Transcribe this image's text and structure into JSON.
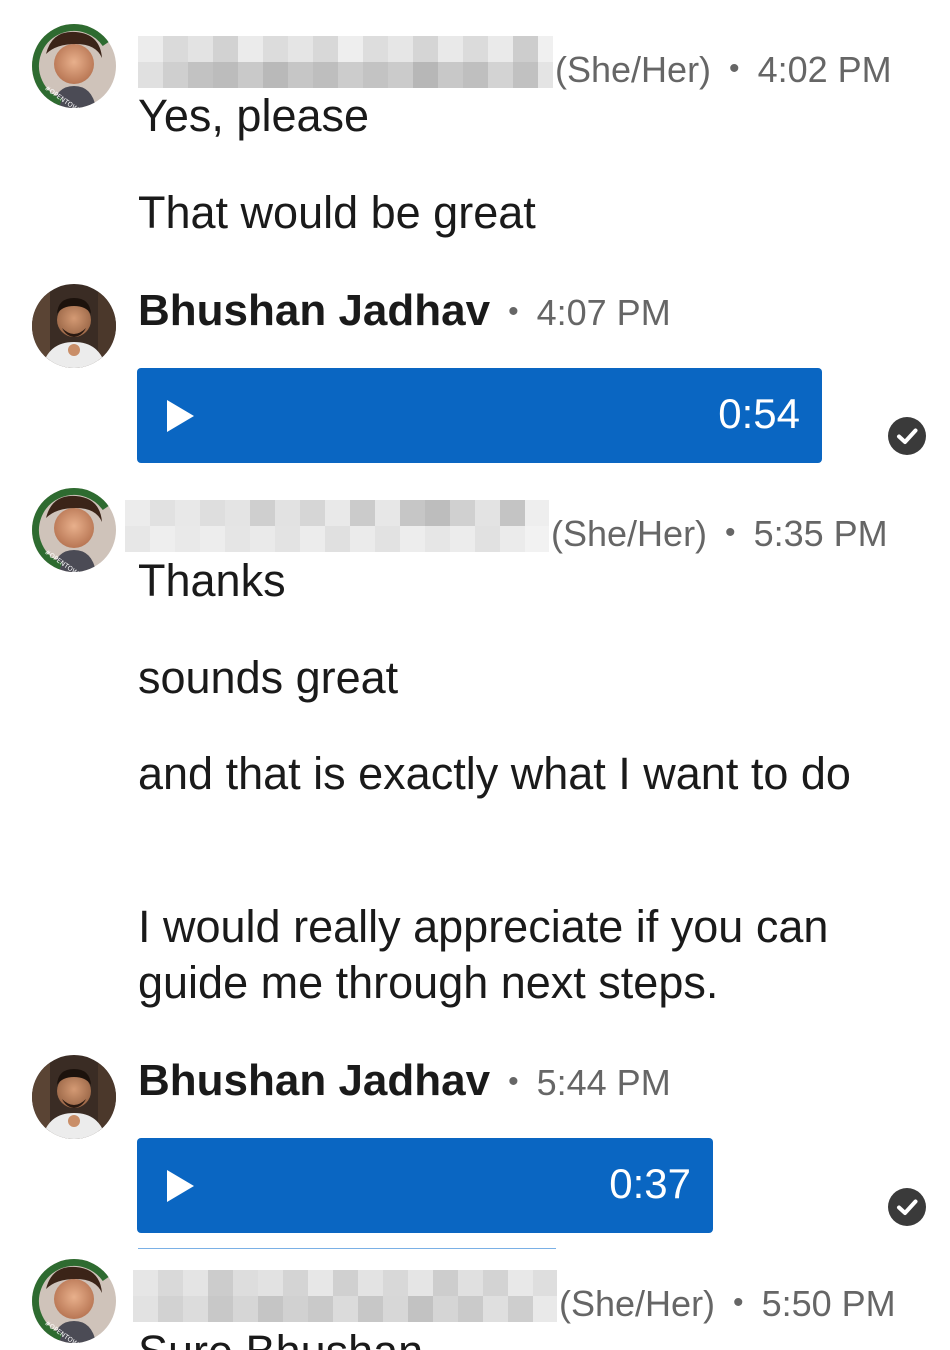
{
  "conversation": {
    "messages": [
      {
        "sender_type": "her",
        "pronoun": "(She/Her)",
        "time": "4:02 PM",
        "lines": [
          "Yes, please",
          "That would be great"
        ]
      },
      {
        "sender_type": "bhushan",
        "name": "Bhushan Jadhav",
        "time": "4:07 PM",
        "voice_duration": "0:54"
      },
      {
        "sender_type": "her",
        "pronoun": "(She/Her)",
        "time": "5:35 PM",
        "lines": [
          "Thanks",
          "sounds great",
          "and that is exactly what I want to do",
          "I would really appreciate if you can guide me through next steps."
        ]
      },
      {
        "sender_type": "bhushan",
        "name": "Bhushan Jadhav",
        "time": "5:44 PM",
        "voice_duration": "0:37"
      },
      {
        "sender_type": "her",
        "pronoun": "(She/Her)",
        "time": "5:50 PM",
        "lines": [
          "Sure Bhushan"
        ]
      }
    ]
  },
  "avatar_badge_text": "#OPENTOWORK",
  "colors": {
    "voice_bubble": "#0a66c2",
    "open_to_work_ring": "#2e6b30",
    "read_receipt": "#3a3a3a",
    "meta_text": "#666666"
  },
  "icons": {
    "play": "play-icon",
    "read_receipt": "checkmark-circle-icon"
  }
}
